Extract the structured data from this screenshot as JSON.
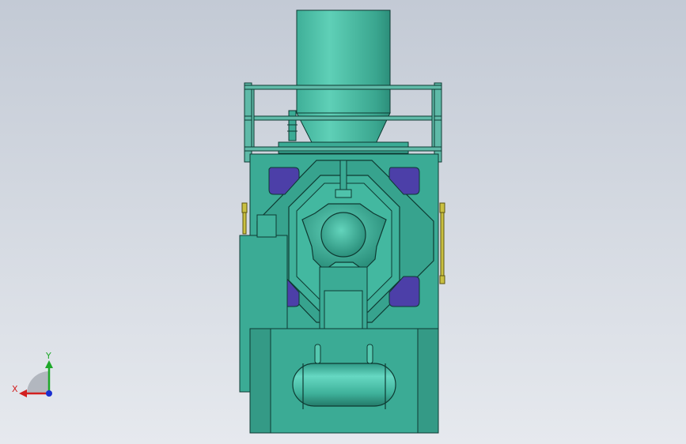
{
  "viewport": {
    "background_top": "#c5ccd6",
    "background_bottom": "#e4e8ee"
  },
  "model": {
    "body_color": "#3bab95",
    "body_light": "#55c9b0",
    "body_dark": "#1f7a69",
    "edge_color": "#0e3a32",
    "window_color": "#4c3fa8",
    "rail_color": "#5fb8a8",
    "rod_color": "#c9c040"
  },
  "triad": {
    "x_label": "X",
    "y_label": "Y",
    "x_color": "#d22020",
    "y_color": "#1ea82a",
    "z_color": "#1a2fd0"
  }
}
